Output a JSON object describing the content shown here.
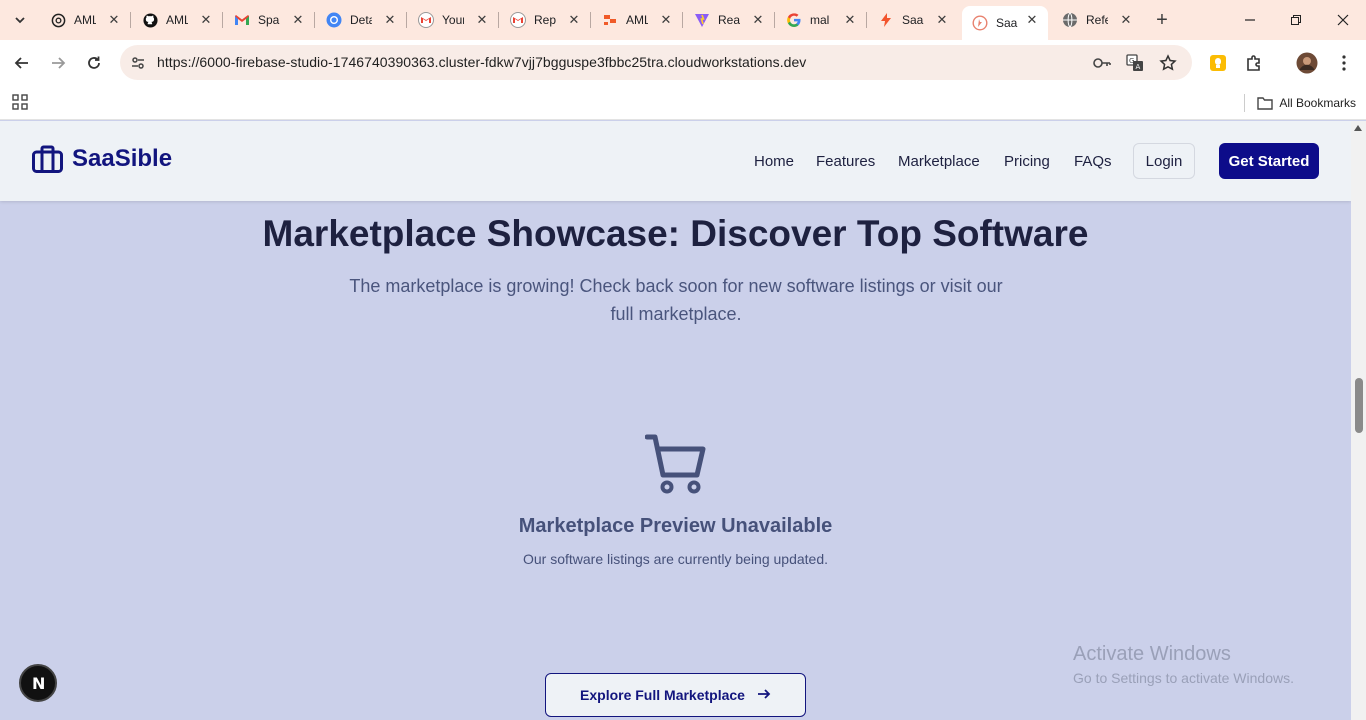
{
  "browser": {
    "tabs": [
      {
        "title": "AML",
        "icon": "openai-icon"
      },
      {
        "title": "AML",
        "icon": "github-icon"
      },
      {
        "title": "Spam",
        "icon": "gmail-icon"
      },
      {
        "title": "Detail",
        "icon": "chrome-icon"
      },
      {
        "title": "Your",
        "icon": "gmail-icon"
      },
      {
        "title": "Rep",
        "icon": "gmail-icon"
      },
      {
        "title": "AML",
        "icon": "orange-shape-icon"
      },
      {
        "title": "Read",
        "icon": "vite-icon"
      },
      {
        "title": "mal",
        "icon": "google-icon"
      },
      {
        "title": "SaaS",
        "icon": "bolt-icon"
      },
      {
        "title": "SaaS",
        "icon": "firebase-studio-icon",
        "active": true
      },
      {
        "title": "Refe",
        "icon": "globe-icon"
      }
    ],
    "url": "https://6000-firebase-studio-1746740390363.cluster-fdkw7vjj7bgguspe3fbbc25tra.cloudworkstations.dev",
    "all_bookmarks_label": "All Bookmarks"
  },
  "site": {
    "brand": "SaaSible",
    "nav": [
      "Home",
      "Features",
      "Marketplace",
      "Pricing",
      "FAQs"
    ],
    "login_label": "Login",
    "get_started_label": "Get Started"
  },
  "main": {
    "title": "Marketplace Showcase: Discover Top Software",
    "subtitle": "The marketplace is growing! Check back soon for new software listings or visit our full marketplace.",
    "empty_title": "Marketplace Preview Unavailable",
    "empty_subtitle": "Our software listings are currently being updated.",
    "explore_label": "Explore Full Marketplace"
  },
  "overlay": {
    "next_badge_letter": "N",
    "watermark_line1": "Activate Windows",
    "watermark_line2": "Go to Settings to activate Windows."
  },
  "colors": {
    "brand": "#12157e",
    "cta": "#0d0c8a",
    "page_bg": "#cbd0ea",
    "tab_strip": "#fde8df"
  }
}
